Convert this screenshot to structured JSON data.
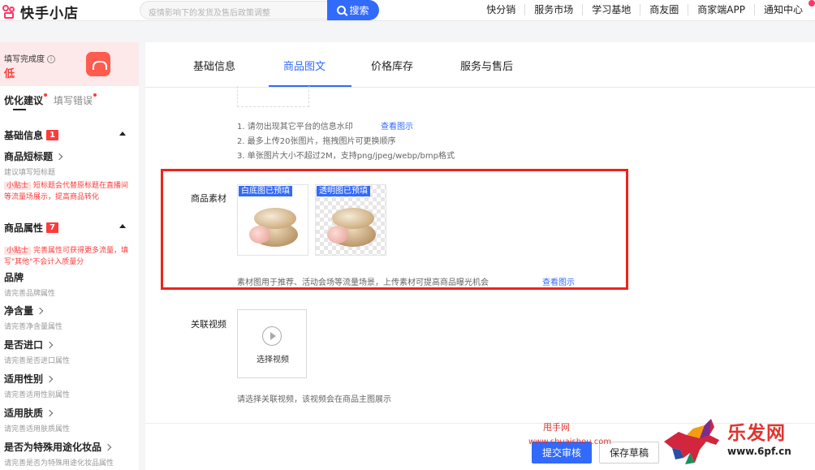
{
  "header": {
    "app_name": "快手小店",
    "search_placeholder": "疫情影响下的发货及售后政策调整",
    "search_button": "搜索",
    "nav": [
      "快分销",
      "服务市场",
      "学习基地",
      "商友圈",
      "商家端APP",
      "通知中心"
    ]
  },
  "sidebar": {
    "completion_label": "填写完成度",
    "completion_level": "低",
    "tabs": [
      "优化建议",
      "填写错误"
    ],
    "basic_section": {
      "title": "基础信息",
      "count": "1"
    },
    "short_title": {
      "name": "商品短标题",
      "hint": "建议填写短标题"
    },
    "tip1": {
      "tag": "小贴士",
      "text": "短标题会代替原标题在直播间等流量场展示，提高商品转化"
    },
    "attr_section": {
      "title": "商品属性",
      "count": "7"
    },
    "tip2": {
      "tag": "小贴士",
      "text": "完善属性可获得更多流量，填写\"其他\"不会计入质量分"
    },
    "fields": [
      {
        "name": "品牌",
        "hint": "请完善品牌属性"
      },
      {
        "name": "净含量",
        "hint": "请完善净含量属性"
      },
      {
        "name": "是否进口",
        "hint": "请完善是否进口属性"
      },
      {
        "name": "适用性别",
        "hint": "请完善适用性别属性"
      },
      {
        "name": "适用肤质",
        "hint": "请完善适用肤质属性"
      },
      {
        "name": "是否为特殊用途化妆品",
        "hint": "请完善是否为特殊用途化妆品属性"
      }
    ]
  },
  "tabs": [
    "基础信息",
    "商品图文",
    "价格库存",
    "服务与售后"
  ],
  "main": {
    "notes": [
      "1. 请勿出现其它平台的信息水印",
      "2. 最多上传20张图片，拖拽图片可更换顺序",
      "3. 单张图片大小不超过2M，支持png/jpeg/webp/bmp格式"
    ],
    "view_example": "查看图示",
    "material_label": "商品素材",
    "material_tags": [
      "白底图已预填",
      "透明图已预填"
    ],
    "material_note": "素材图用于推荐、活动会场等流量场景，上传素材可提高商品曝光机会",
    "video_label": "关联视频",
    "video_button": "选择视频",
    "video_note": "请选择关联视频，该视频会在商品主图展示"
  },
  "footer": {
    "submit": "提交审核",
    "draft": "保存草稿"
  },
  "watermark": {
    "site_cn": "甩手网",
    "site_url": "www.shuaishou.com",
    "logo_cn": "乐发网",
    "logo_url": "www.6pf.cn"
  },
  "colors": {
    "accent": "#326bfb",
    "alert": "#f0231c",
    "brand": "#fe3666"
  }
}
